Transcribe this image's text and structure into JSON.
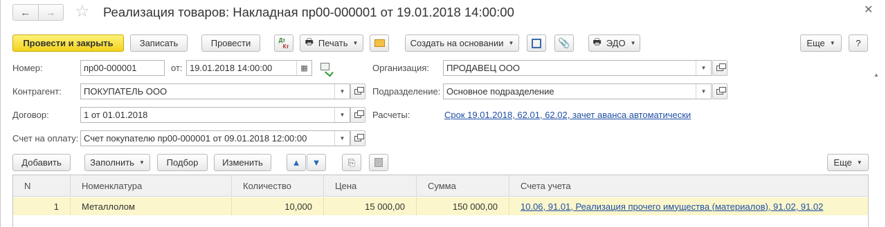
{
  "window": {
    "title": "Реализация товаров: Накладная пр00-000001 от 19.01.2018 14:00:00"
  },
  "toolbar": {
    "post_close_label": "Провести и закрыть",
    "save_label": "Записать",
    "post_label": "Провести",
    "dt_kt_label": "Дт Кт",
    "print_label": "Печать",
    "create_based_label": "Создать на основании",
    "edo_label": "ЭДО",
    "more_label": "Еще",
    "help_label": "?"
  },
  "form": {
    "number": {
      "label": "Номер:",
      "value": "пр00-000001"
    },
    "date": {
      "label": "от:",
      "value": "19.01.2018 14:00:00"
    },
    "organization": {
      "label": "Организация:",
      "value": "ПРОДАВЕЦ ООО"
    },
    "counterparty": {
      "label": "Контрагент:",
      "value": "ПОКУПАТЕЛЬ ООО"
    },
    "division": {
      "label": "Подразделение:",
      "value": "Основное подразделение"
    },
    "contract": {
      "label": "Договор:",
      "value": "1 от 01.01.2018"
    },
    "settlements": {
      "label": "Расчеты:",
      "value": "Срок 19.01.2018, 62.01, 62.02, зачет аванса автоматически"
    },
    "invoice": {
      "label": "Счет на оплату:",
      "value": "Счет покупателю пр00-000001 от 09.01.2018 12:00:00"
    }
  },
  "table_toolbar": {
    "add_label": "Добавить",
    "fill_label": "Заполнить",
    "pick_label": "Подбор",
    "change_label": "Изменить",
    "more_label": "Еще"
  },
  "table": {
    "columns": [
      "N",
      "Номенклатура",
      "Количество",
      "Цена",
      "Сумма",
      "Счета учета"
    ],
    "rows": [
      {
        "n": "1",
        "item": "Металлолом",
        "qty": "10,000",
        "price": "15 000,00",
        "sum": "150 000,00",
        "accounts": "10.06, 91.01, Реализация прочего имущества (материалов), 91.02, 91.02"
      }
    ]
  }
}
